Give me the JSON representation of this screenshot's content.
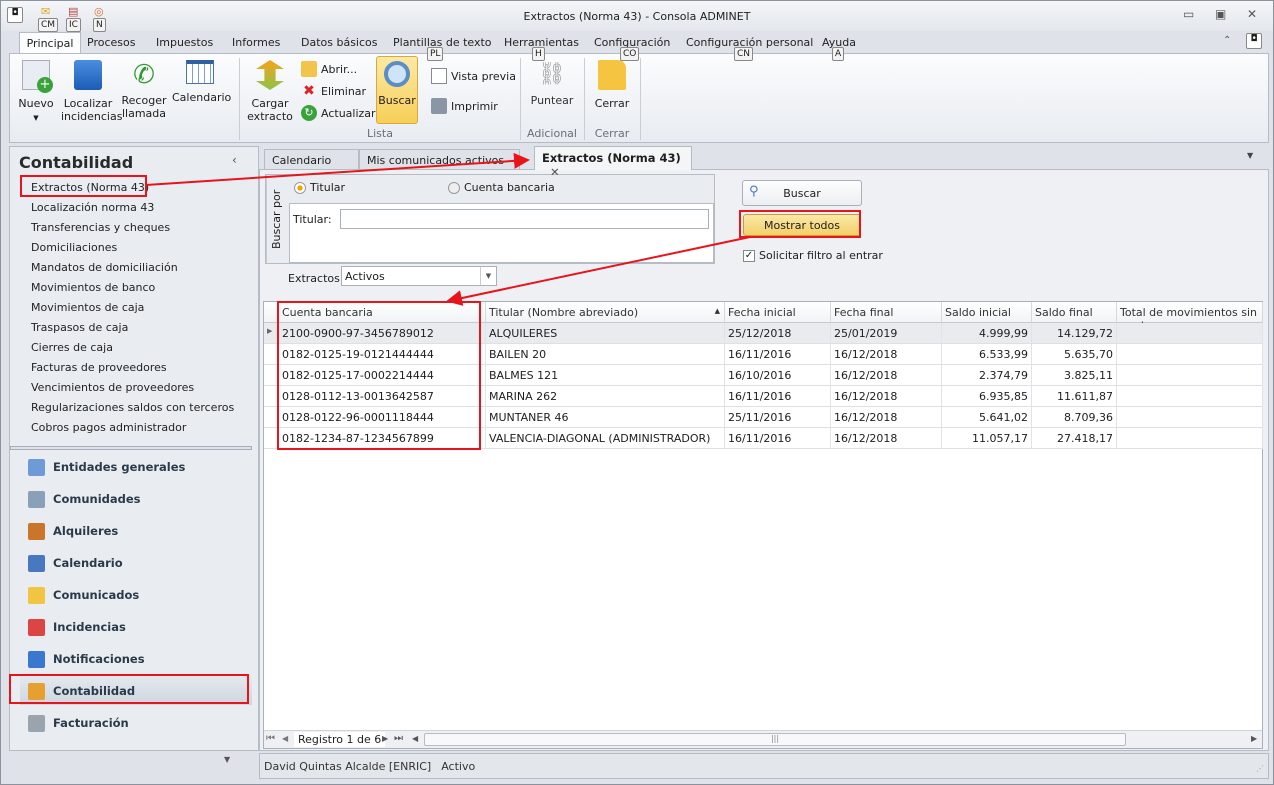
{
  "window": {
    "title": "Extractos (Norma 43) - Consola ADMINET",
    "quick_access_keys": [
      "CM",
      "IC",
      "N"
    ]
  },
  "ribbon": {
    "tabs": [
      "Principal",
      "Procesos",
      "Impuestos",
      "Informes",
      "Datos básicos",
      "Plantillas de texto",
      "Herramientas",
      "Configuración",
      "Configuración personal",
      "Ayuda"
    ],
    "keytips": {
      "plantillas": "PL",
      "herramientas": "H",
      "configuracion": "CO",
      "configuracion_personal": "CN",
      "ayuda": "A"
    },
    "buttons": {
      "nuevo": "Nuevo",
      "localizar": "Localizar incidencias",
      "recoger": "Recoger llamada",
      "calendario": "Calendario",
      "cargar": "Cargar extracto",
      "abrir": "Abrir...",
      "eliminar": "Eliminar",
      "actualizar": "Actualizar",
      "buscar": "Buscar",
      "vista_previa": "Vista previa",
      "imprimir": "Imprimir",
      "puntear": "Puntear",
      "cerrar": "Cerrar"
    },
    "groups": {
      "lista": "Lista",
      "adicional": "Adicional",
      "cerrar": "Cerrar"
    }
  },
  "sidebar": {
    "title": "Contabilidad",
    "items": [
      "Extractos (Norma 43)",
      "Localización norma 43",
      "Transferencias y cheques",
      "Domiciliaciones",
      "Mandatos de domiciliación",
      "Movimientos de banco",
      "Movimientos de caja",
      "Traspasos de caja",
      "Cierres de caja",
      "Facturas de proveedores",
      "Vencimientos de proveedores",
      "Regularizaciones saldos con terceros",
      "Cobros pagos administrador"
    ],
    "nav": [
      "Entidades generales",
      "Comunidades",
      "Alquileres",
      "Calendario",
      "Comunicados",
      "Incidencias",
      "Notificaciones",
      "Contabilidad",
      "Facturación"
    ],
    "selected_nav": "Contabilidad"
  },
  "doc_tabs": [
    "Calendario",
    "Mis comunicados activos",
    "Extractos (Norma 43)"
  ],
  "filter": {
    "group_label": "Buscar por",
    "radio_titular": "Titular",
    "radio_cuenta": "Cuenta bancaria",
    "selected": "Titular",
    "titular_label": "Titular:",
    "titular_value": "",
    "extractos_label": "Extractos:",
    "extractos_value": "Activos",
    "buscar": "Buscar",
    "mostrar_todos": "Mostrar todos",
    "solicitar": "Solicitar filtro al entrar",
    "solicitar_checked": true
  },
  "grid": {
    "columns": [
      "Cuenta bancaria",
      "Titular (Nombre abreviado)",
      "Fecha inicial",
      "Fecha final",
      "Saldo inicial",
      "Saldo final",
      "Total de movimientos sin punt"
    ],
    "rows": [
      [
        "2100-0900-97-3456789012",
        "ALQUILERES",
        "25/12/2018",
        "25/01/2019",
        "4.999,99",
        "14.129,72",
        ""
      ],
      [
        "0182-0125-19-0121444444",
        "BAILEN 20",
        "16/11/2016",
        "16/12/2018",
        "6.533,99",
        "5.635,70",
        ""
      ],
      [
        "0182-0125-17-0002214444",
        "BALMES 121",
        "16/10/2016",
        "16/12/2018",
        "2.374,79",
        "3.825,11",
        ""
      ],
      [
        "0128-0112-13-0013642587",
        "MARINA 262",
        "16/11/2016",
        "16/12/2018",
        "6.935,85",
        "11.611,87",
        ""
      ],
      [
        "0128-0122-96-0001118444",
        "MUNTANER 46",
        "25/11/2016",
        "16/12/2018",
        "5.641,02",
        "8.709,36",
        ""
      ],
      [
        "0182-1234-87-1234567899",
        "VALENCIA-DIAGONAL (ADMINISTRADOR)",
        "16/11/2016",
        "16/12/2018",
        "11.057,17",
        "27.418,17",
        ""
      ]
    ],
    "record_nav": "Registro 1 de 6"
  },
  "status": {
    "user": "David Quintas Alcalde [ENRIC]",
    "state": "Activo"
  },
  "colors": {
    "annotation": "#e8141c",
    "selected_button": "#fbd96b"
  }
}
